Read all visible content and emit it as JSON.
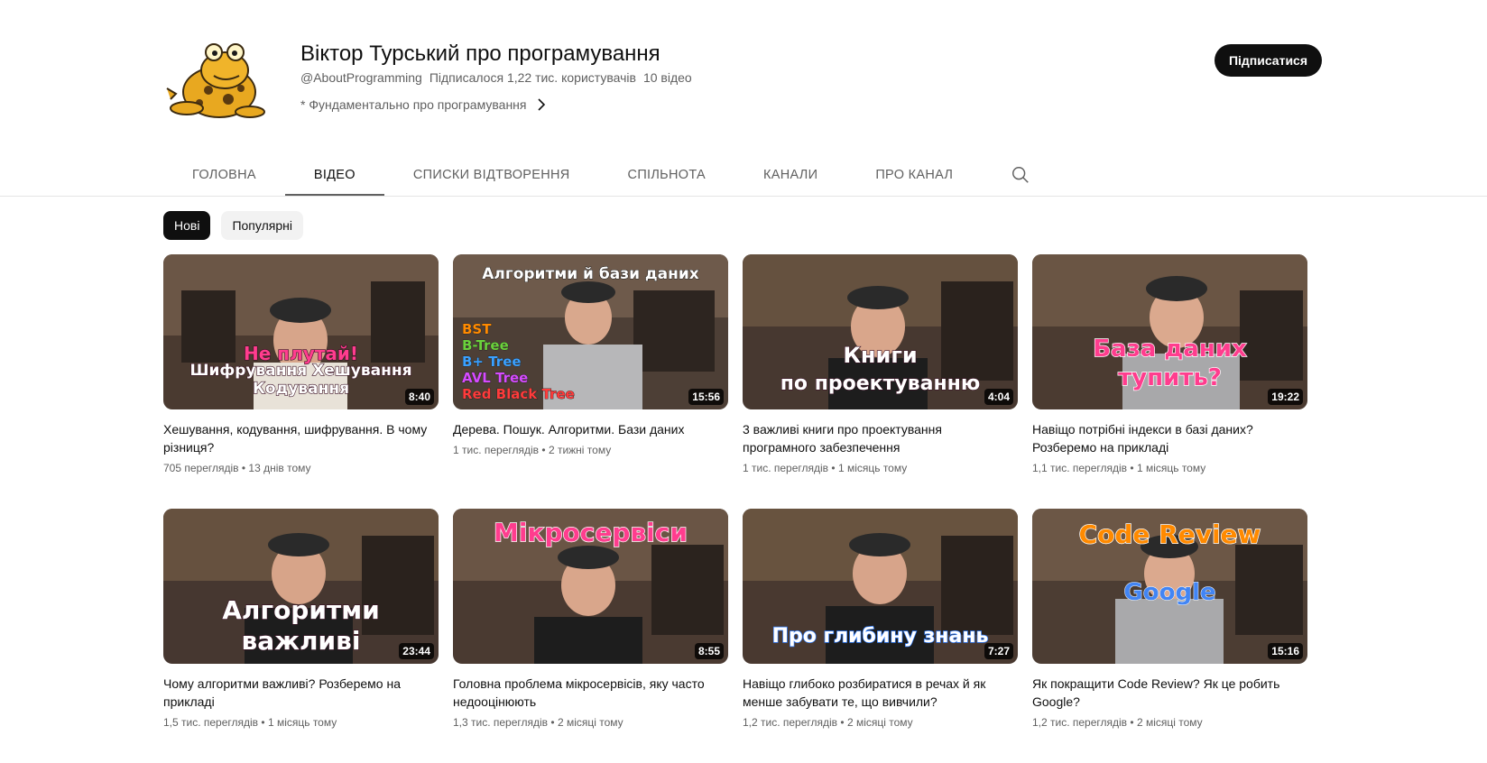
{
  "channel": {
    "title": "Віктор Турський про програмування",
    "handle": "@AboutProgramming",
    "subscribers": "Підписалося 1,22 тис. користувачів",
    "video_count": "10 відео",
    "description": "* Фундаментально про програмування",
    "subscribe_label": "Підписатися",
    "avatar_icon": "frog-avatar-icon"
  },
  "tabs": [
    {
      "label": "ГОЛОВНА"
    },
    {
      "label": "ВІДЕО"
    },
    {
      "label": "СПИСКИ ВІДТВОРЕННЯ"
    },
    {
      "label": "СПІЛЬНОТА"
    },
    {
      "label": "КАНАЛИ"
    },
    {
      "label": "ПРО КАНАЛ"
    }
  ],
  "active_tab": "ВІДЕО",
  "chips": [
    {
      "label": "Нові"
    },
    {
      "label": "Популярні"
    }
  ],
  "videos": [
    {
      "title": "Хешування, кодування, шифрування. В чому різниця?",
      "views": "705 переглядів",
      "age": "13 днів тому",
      "duration": "8:40",
      "thumb_lines": [
        "Не плутай!",
        "Шифрування Хешування",
        "Кодування"
      ]
    },
    {
      "title": "Дерева. Пошук. Алгоритми. Бази даних",
      "views": "1 тис. переглядів",
      "age": "2 тижні тому",
      "duration": "15:56",
      "thumb_lines": [
        "Алгоритми й бази даних",
        "BST",
        "B-Tree",
        "B+ Tree",
        "AVL Tree",
        "Red Black Tree"
      ]
    },
    {
      "title": "3 важливі книги про проектування програмного забезпечення",
      "views": "1 тис. переглядів",
      "age": "1 місяць тому",
      "duration": "4:04",
      "thumb_lines": [
        "Книги",
        "по проектуванню"
      ]
    },
    {
      "title": "Навіщо потрібні індекси в базі даних? Розберемо на прикладі",
      "views": "1,1 тис. переглядів",
      "age": "1 місяць тому",
      "duration": "19:22",
      "thumb_lines": [
        "База даних",
        "тупить?"
      ]
    },
    {
      "title": "Чому алгоритми важливі? Розберемо на прикладі",
      "views": "1,5 тис. переглядів",
      "age": "1 місяць тому",
      "duration": "23:44",
      "thumb_lines": [
        "Алгоритми",
        "важливі"
      ]
    },
    {
      "title": "Головна проблема мікросервісів, яку часто недооцінюють",
      "views": "1,3 тис. переглядів",
      "age": "2 місяці тому",
      "duration": "8:55",
      "thumb_lines": [
        "Мікросервіси"
      ]
    },
    {
      "title": "Навіщо глибоко розбиратися в речах й як менше забувати те, що вивчили?",
      "views": "1,2 тис. переглядів",
      "age": "2 місяці тому",
      "duration": "7:27",
      "thumb_lines": [
        "Про глибину знань"
      ]
    },
    {
      "title": "Як покращити Code Review? Як це робить Google?",
      "views": "1,2 тис. переглядів",
      "age": "2 місяці тому",
      "duration": "15:16",
      "thumb_lines": [
        "Code Review",
        "Google"
      ]
    }
  ],
  "colors": {
    "thumb_text_pink": "#ff3d8e",
    "thumb_text_white": "#ffffff",
    "thumb_text_orange": "#ff8a00",
    "thumb_text_blue": "#2b7bff"
  }
}
